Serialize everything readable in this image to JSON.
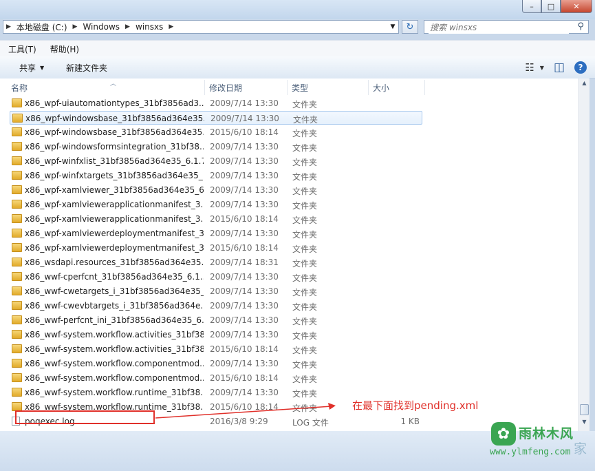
{
  "window": {
    "min_glyph": "–",
    "max_glyph": "□",
    "close_glyph": "✕"
  },
  "address": {
    "crumbs": [
      "本地磁盘 (C:)",
      "Windows",
      "winsxs"
    ]
  },
  "search": {
    "placeholder": "搜索 winsxs"
  },
  "menu": {
    "tools": "工具(T)",
    "help": "帮助(H)"
  },
  "toolbar": {
    "share": "共享",
    "new_folder": "新建文件夹"
  },
  "columns": {
    "name": "名称",
    "date": "修改日期",
    "type": "类型",
    "size": "大小"
  },
  "rows": [
    {
      "name": "x86_wpf-uiautomationtypes_31bf3856ad3...",
      "date": "2009/7/14 13:30",
      "type": "文件夹",
      "size": "",
      "kind": "folder"
    },
    {
      "name": "x86_wpf-windowsbase_31bf3856ad364e35...",
      "date": "2009/7/14 13:30",
      "type": "文件夹",
      "size": "",
      "kind": "folder",
      "selected": true
    },
    {
      "name": "x86_wpf-windowsbase_31bf3856ad364e35...",
      "date": "2015/6/10 18:14",
      "type": "文件夹",
      "size": "",
      "kind": "folder"
    },
    {
      "name": "x86_wpf-windowsformsintegration_31bf38...",
      "date": "2009/7/14 13:30",
      "type": "文件夹",
      "size": "",
      "kind": "folder"
    },
    {
      "name": "x86_wpf-winfxlist_31bf3856ad364e35_6.1.7...",
      "date": "2009/7/14 13:30",
      "type": "文件夹",
      "size": "",
      "kind": "folder"
    },
    {
      "name": "x86_wpf-winfxtargets_31bf3856ad364e35_...",
      "date": "2009/7/14 13:30",
      "type": "文件夹",
      "size": "",
      "kind": "folder"
    },
    {
      "name": "x86_wpf-xamlviewer_31bf3856ad364e35_6...",
      "date": "2009/7/14 13:30",
      "type": "文件夹",
      "size": "",
      "kind": "folder"
    },
    {
      "name": "x86_wpf-xamlviewerapplicationmanifest_3...",
      "date": "2009/7/14 13:30",
      "type": "文件夹",
      "size": "",
      "kind": "folder"
    },
    {
      "name": "x86_wpf-xamlviewerapplicationmanifest_3...",
      "date": "2015/6/10 18:14",
      "type": "文件夹",
      "size": "",
      "kind": "folder"
    },
    {
      "name": "x86_wpf-xamlviewerdeploymentmanifest_3...",
      "date": "2009/7/14 13:30",
      "type": "文件夹",
      "size": "",
      "kind": "folder"
    },
    {
      "name": "x86_wpf-xamlviewerdeploymentmanifest_3...",
      "date": "2015/6/10 18:14",
      "type": "文件夹",
      "size": "",
      "kind": "folder"
    },
    {
      "name": "x86_wsdapi.resources_31bf3856ad364e35...",
      "date": "2009/7/14 18:31",
      "type": "文件夹",
      "size": "",
      "kind": "folder"
    },
    {
      "name": "x86_wwf-cperfcnt_31bf3856ad364e35_6.1....",
      "date": "2009/7/14 13:30",
      "type": "文件夹",
      "size": "",
      "kind": "folder"
    },
    {
      "name": "x86_wwf-cwetargets_i_31bf3856ad364e35_...",
      "date": "2009/7/14 13:30",
      "type": "文件夹",
      "size": "",
      "kind": "folder"
    },
    {
      "name": "x86_wwf-cwevbtargets_i_31bf3856ad364e...",
      "date": "2009/7/14 13:30",
      "type": "文件夹",
      "size": "",
      "kind": "folder"
    },
    {
      "name": "x86_wwf-perfcnt_ini_31bf3856ad364e35_6....",
      "date": "2009/7/14 13:30",
      "type": "文件夹",
      "size": "",
      "kind": "folder"
    },
    {
      "name": "x86_wwf-system.workflow.activities_31bf38...",
      "date": "2009/7/14 13:30",
      "type": "文件夹",
      "size": "",
      "kind": "folder"
    },
    {
      "name": "x86_wwf-system.workflow.activities_31bf38...",
      "date": "2015/6/10 18:14",
      "type": "文件夹",
      "size": "",
      "kind": "folder"
    },
    {
      "name": "x86_wwf-system.workflow.componentmod...",
      "date": "2009/7/14 13:30",
      "type": "文件夹",
      "size": "",
      "kind": "folder"
    },
    {
      "name": "x86_wwf-system.workflow.componentmod...",
      "date": "2015/6/10 18:14",
      "type": "文件夹",
      "size": "",
      "kind": "folder"
    },
    {
      "name": "x86_wwf-system.workflow.runtime_31bf38...",
      "date": "2009/7/14 13:30",
      "type": "文件夹",
      "size": "",
      "kind": "folder"
    },
    {
      "name": "x86_wwf-system.workflow.runtime_31bf38...",
      "date": "2015/6/10 18:14",
      "type": "文件夹",
      "size": "",
      "kind": "folder"
    },
    {
      "name": "poqexec.log",
      "date": "2016/3/8 9:29",
      "type": "LOG 文件",
      "size": "1 KB",
      "kind": "file"
    }
  ],
  "annotation": {
    "text": "在最下面找到pending.xml",
    "color": "#e0302a"
  },
  "watermark": {
    "name": "雨林木风",
    "url": "www.ylmfeng.com",
    "extra": "家",
    "color": "#3aa552"
  },
  "icons": {
    "refresh": "↻",
    "search": "⚲",
    "dropdown": "▼",
    "view": "☷",
    "pane": "◫",
    "help": "?",
    "sort_up": "︿",
    "scroll_up": "▲",
    "scroll_down": "▼",
    "logo": "✿"
  }
}
